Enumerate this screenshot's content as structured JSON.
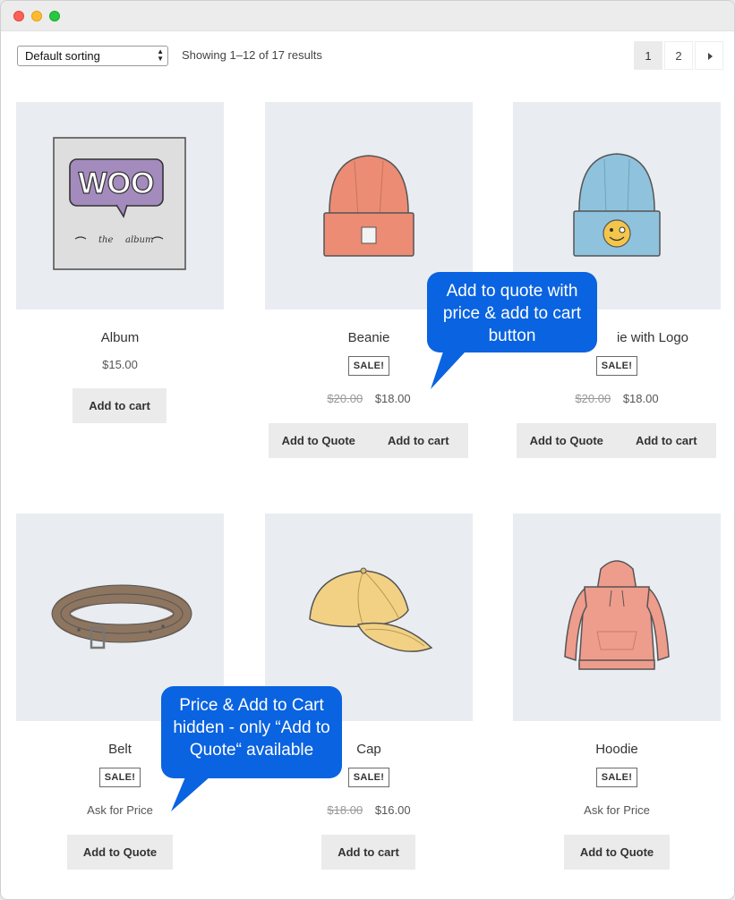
{
  "toolbar": {
    "sort_value": "Default sorting",
    "result_count": "Showing 1–12 of 17 results",
    "pages": [
      "1",
      "2"
    ],
    "next_icon": "caret-right-icon"
  },
  "products": [
    {
      "name": "Album",
      "price": "$15.00",
      "button": "Add to cart",
      "image_icon": "woo-album-icon"
    },
    {
      "name": "Beanie",
      "badge": "SALE!",
      "old_price": "$20.00",
      "price": "$18.00",
      "quote_button": "Add to Quote",
      "cart_button": "Add to cart",
      "image_icon": "beanie-icon"
    },
    {
      "name": "ie with Logo",
      "badge": "SALE!",
      "old_price": "$20.00",
      "price": "$18.00",
      "quote_button": "Add to Quote",
      "cart_button": "Add to cart",
      "image_icon": "beanie-logo-icon"
    },
    {
      "name": "Belt",
      "badge": "SALE!",
      "price_text": "Ask for Price",
      "button": "Add to Quote",
      "image_icon": "belt-icon"
    },
    {
      "name": "Cap",
      "badge": "SALE!",
      "old_price": "$18.00",
      "price": "$16.00",
      "button": "Add to cart",
      "image_icon": "cap-icon"
    },
    {
      "name": "Hoodie",
      "badge": "SALE!",
      "price_text": "Ask for Price",
      "button": "Add to Quote",
      "image_icon": "hoodie-icon"
    }
  ],
  "callouts": {
    "top": "Add to quote with price & add to cart button",
    "bottom": "Price & Add to Cart hidden - only “Add to Quote“ available"
  },
  "colors": {
    "callout": "#0a63e0",
    "thumb_bg": "#e9edf1",
    "button_bg": "#ebebeb"
  }
}
